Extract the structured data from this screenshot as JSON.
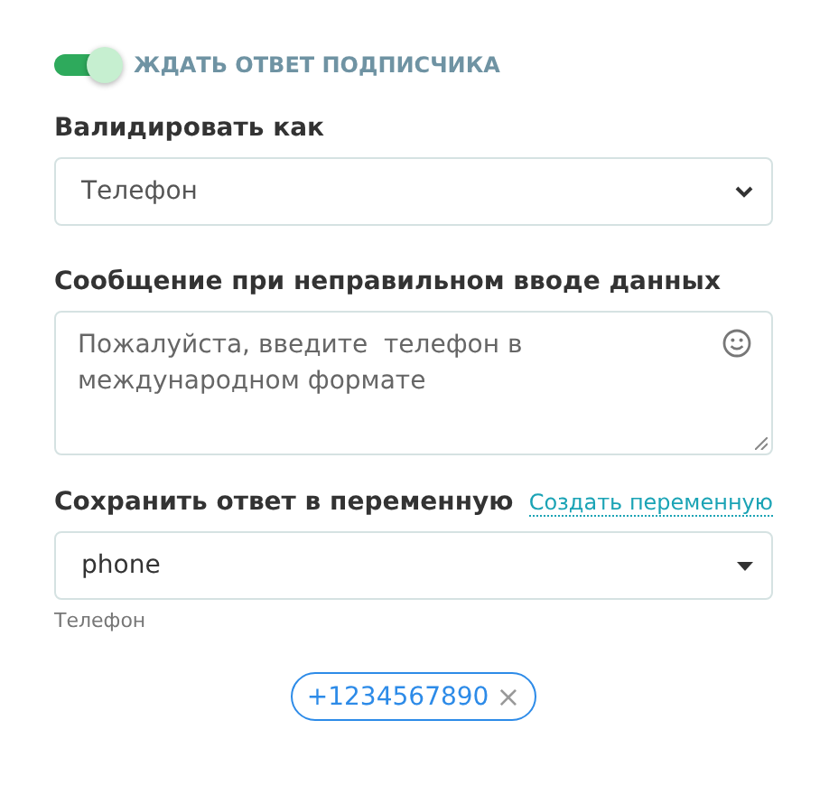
{
  "wait_toggle": {
    "label": "ЖДАТЬ ОТВЕТ ПОДПИСЧИКА",
    "on": true
  },
  "validate": {
    "label": "Валидировать как",
    "value": "Телефон"
  },
  "error_message": {
    "label": "Сообщение при неправильном вводе данных",
    "value": "Пожалуйста, введите  телефон в международном формате"
  },
  "save_variable": {
    "label": "Сохранить ответ в переменную",
    "link": "Создать переменную",
    "value": "phone",
    "hint": "Телефон"
  },
  "tags": [
    {
      "label": "+1234567890",
      "remove": "×"
    }
  ]
}
